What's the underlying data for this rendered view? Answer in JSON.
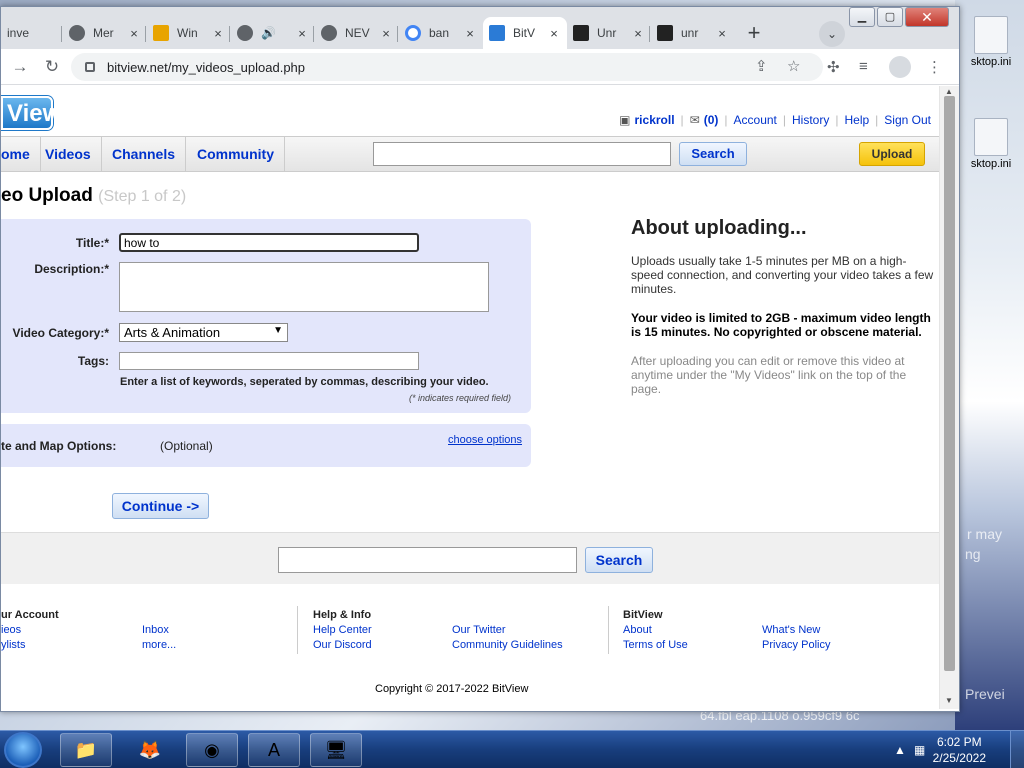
{
  "browser": {
    "tabs": [
      {
        "label": "inve",
        "icon": "page-icon"
      },
      {
        "label": "Mer",
        "icon": "github-icon"
      },
      {
        "label": "Win",
        "icon": "document-icon"
      },
      {
        "label": "",
        "icon": "globe-icon",
        "audio": "🔊"
      },
      {
        "label": "NEV",
        "icon": "globe-icon"
      },
      {
        "label": "ban",
        "icon": "google-icon"
      },
      {
        "label": "BitV",
        "icon": "bitview-icon"
      },
      {
        "label": "Unr",
        "icon": "unreal-icon"
      },
      {
        "label": "unr",
        "icon": "unreal-icon"
      }
    ],
    "close_glyph": "×",
    "newtab_glyph": "+",
    "tabdrop_glyph": "⌄",
    "url": "bitview.net/my_videos_upload.php"
  },
  "header": {
    "logo": "View",
    "username": "rickroll",
    "mail_count": "(0)",
    "links": [
      "Account",
      "History",
      "Help",
      "Sign Out"
    ]
  },
  "nav": {
    "items": [
      "ome",
      "Videos",
      "Channels",
      "Community"
    ],
    "search_button": "Search",
    "upload_button": "Upload"
  },
  "upload": {
    "title": "eo Upload",
    "step": "(Step 1 of 2)",
    "labels": {
      "title": "Title:*",
      "description": "Description:*",
      "category": "Video Category:*",
      "tags": "Tags:"
    },
    "title_value": "how to",
    "category_value": "Arts & Animation",
    "tags_hint": "Enter a list of keywords, seperated by commas, describing your video.",
    "required_note": "(* indicates required field)",
    "options_label": "te and Map Options:",
    "options_optional": "(Optional)",
    "options_link": "choose options",
    "continue_button": "Continue ->"
  },
  "about": {
    "heading": "About uploading...",
    "p1": "Uploads usually take 1-5 minutes per MB on a high-speed connection, and converting your video takes a few minutes.",
    "p2": "Your video is limited to 2GB - maximum video length is 15 minutes. No copyrighted or obscene material.",
    "p3": "After uploading you can edit or remove this video at anytime under the \"My Videos\" link on the top of the page."
  },
  "footer": {
    "search_button": "Search",
    "col1_heading": "ur Account",
    "col1_links": [
      "ieos",
      "ylists"
    ],
    "col1b_links": [
      "Inbox",
      "more..."
    ],
    "col2_heading": "Help & Info",
    "col2_links": [
      "Help Center",
      "Our Discord"
    ],
    "col2b_links": [
      "Our Twitter",
      "Community Guidelines"
    ],
    "col3_heading": "BitView",
    "col3_links": [
      "About",
      "Terms of Use"
    ],
    "col3b_links": [
      "What's New",
      "Privacy Policy"
    ],
    "copyright": "Copyright © 2017-2022 BitView"
  },
  "desktop": {
    "icon1": "sktop.ini",
    "icon2": "sktop.ini",
    "faint1": "r may",
    "faint2": "ng",
    "faint3": "Prevei",
    "faint4": "64.fbl eap.1108 o.959cf9 6c",
    "faint5": "n"
  },
  "taskbar": {
    "time": "6:02 PM",
    "date": "2/25/2022"
  }
}
